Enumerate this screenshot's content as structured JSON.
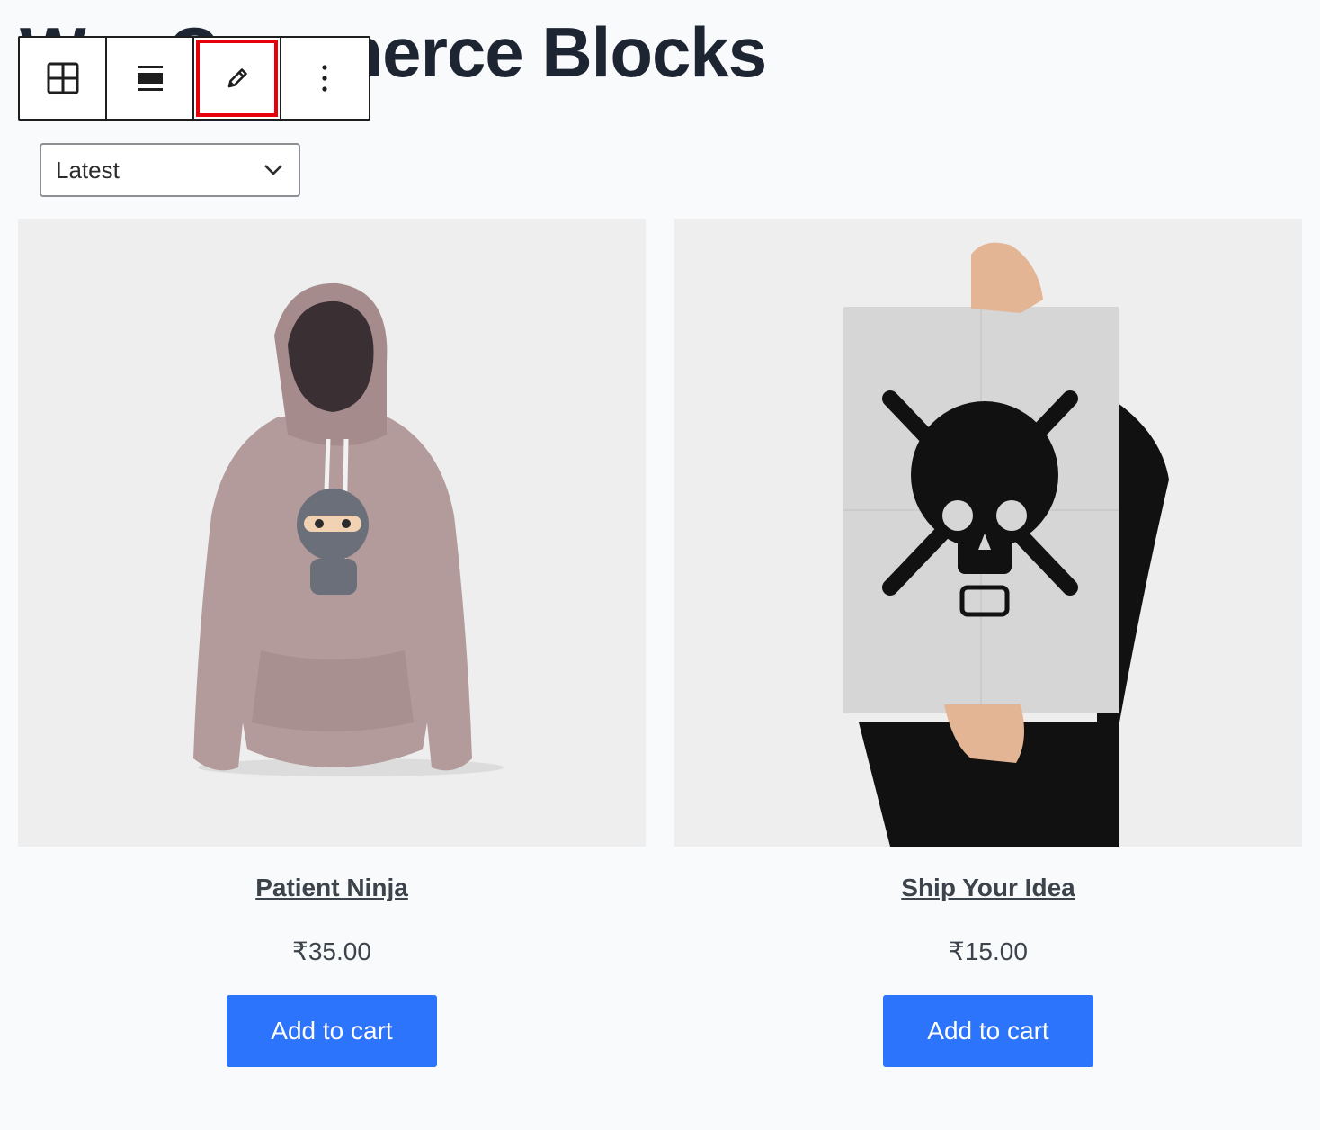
{
  "page": {
    "title": "WooCommerce Blocks"
  },
  "toolbar": {
    "buttons": [
      {
        "icon": "block-grid-icon"
      },
      {
        "icon": "align-icon"
      },
      {
        "icon": "edit-pencil-icon",
        "highlighted": true
      },
      {
        "icon": "more-options-icon"
      }
    ]
  },
  "sort_select": {
    "value": "Latest"
  },
  "products": [
    {
      "name": "Patient Ninja",
      "price": "₹35.00",
      "button": "Add to cart",
      "image": "pink hoodie with ninja print"
    },
    {
      "name": "Ship Your Idea",
      "price": "₹15.00",
      "button": "Add to cart",
      "image": "hands holding poster with skull lightbulb"
    }
  ],
  "colors": {
    "accent": "#2b74fb",
    "highlight": "#e5000b",
    "title": "#1e2532"
  }
}
